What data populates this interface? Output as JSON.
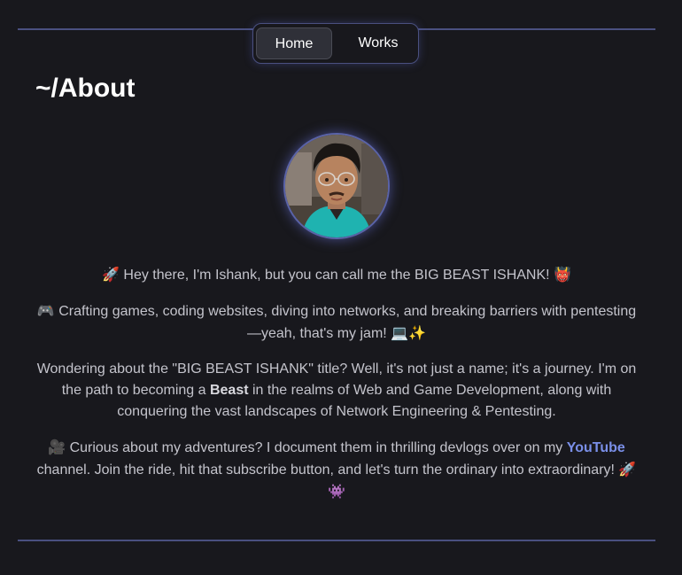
{
  "nav": {
    "home_label": "Home",
    "works_label": "Works"
  },
  "page": {
    "title": "~/About"
  },
  "about": {
    "p1_emoji_start": "🚀",
    "p1_text": "Hey there, I'm Ishank, but you can call me the BIG BEAST ISHANK!",
    "p1_emoji_end": "👹",
    "p2_emoji_start": "🎮",
    "p2_text": "Crafting games, coding websites, diving into networks, and breaking barriers with pentesting—yeah, that's my jam!",
    "p2_emoji_end": "💻✨",
    "p3_text_before": "Wondering about the \"BIG BEAST ISHANK\" title? Well, it's not just a name; it's a journey. I'm on the path to becoming a",
    "p3_bold": "Beast",
    "p3_text_after": "in the realms of Web and Game Development, along with conquering the vast landscapes of Network Engineering & Pentesting.",
    "p4_emoji_start": "🎥",
    "p4_text_before": "Curious about my adventures? I document them in thrilling devlogs over on my",
    "p4_link": "YouTube",
    "p4_text_after": "channel. Join the ride, hit that subscribe button, and let's turn the ordinary into extraordinary!",
    "p4_emoji_end": "🚀👾"
  },
  "colors": {
    "background": "#18181d",
    "accent": "#4a5080",
    "link": "#7a8fe8"
  }
}
